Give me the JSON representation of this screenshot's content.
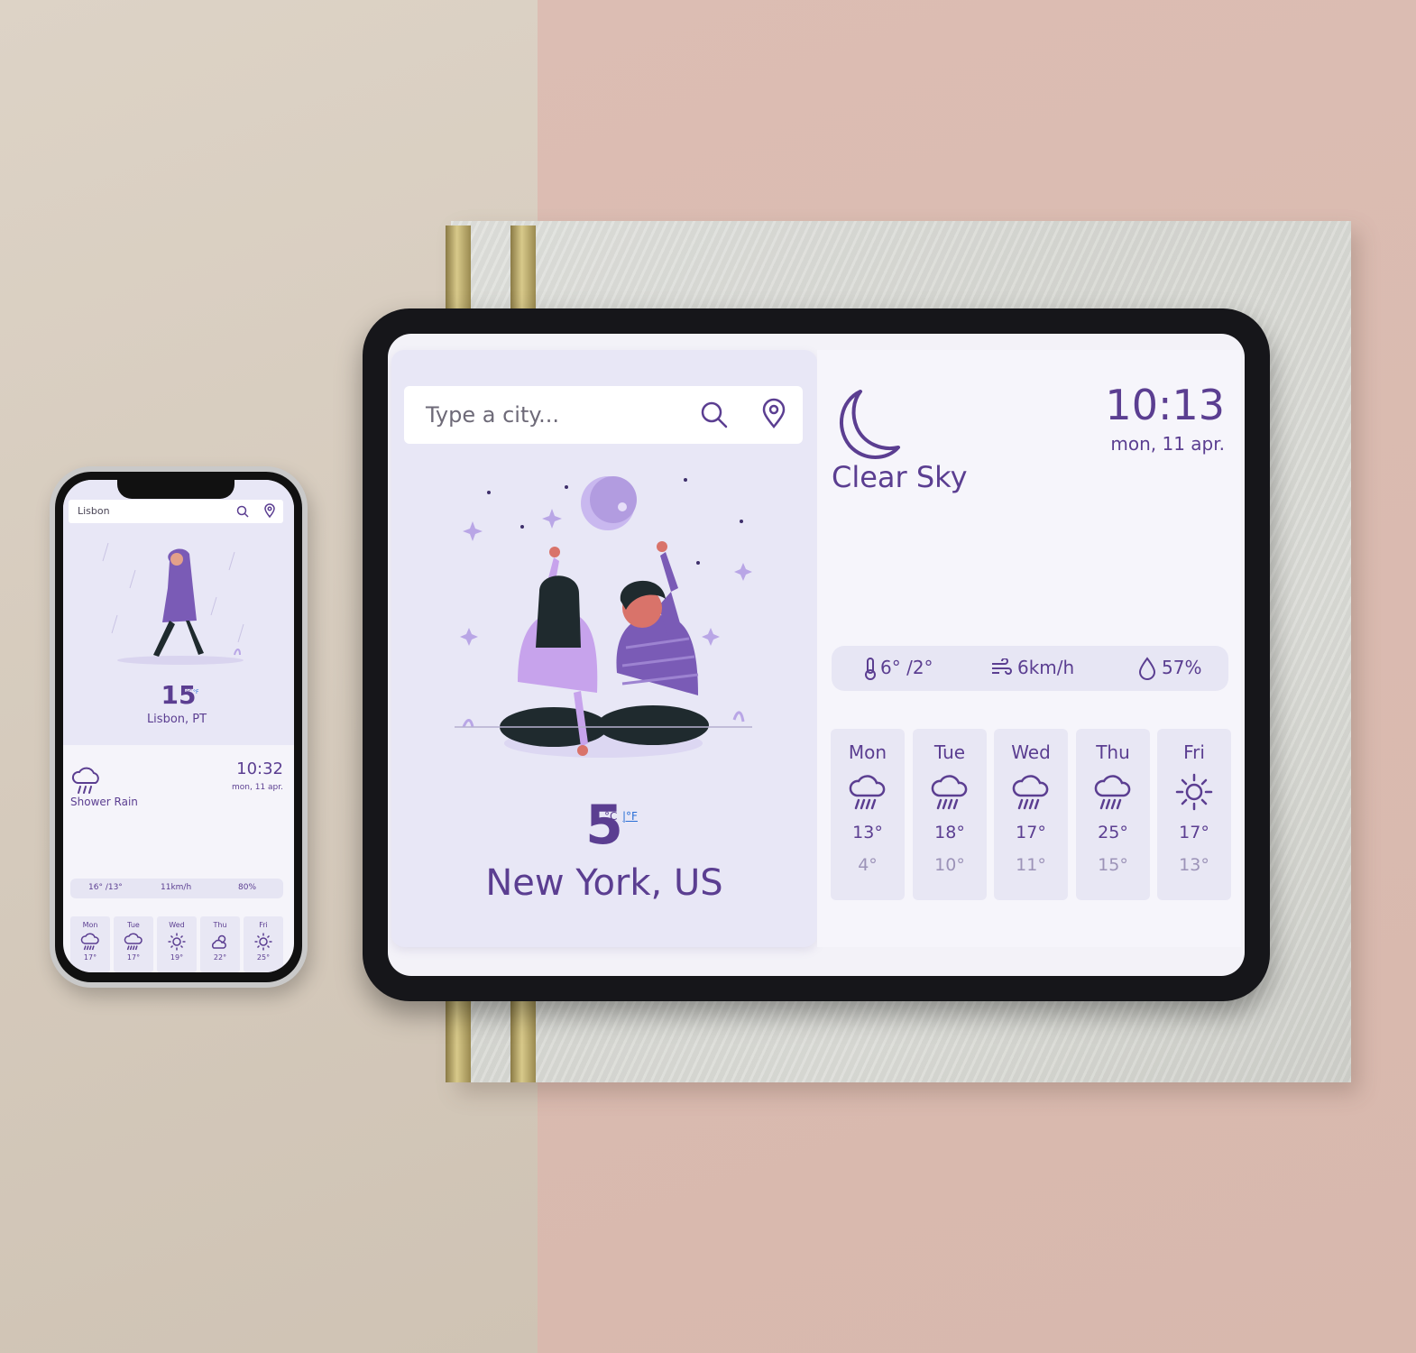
{
  "colors": {
    "accent": "#5b3e91",
    "panel": "#e8e7f6",
    "light_accent": "#b9a6e6"
  },
  "tablet": {
    "search": {
      "placeholder": "Type a city..."
    },
    "current": {
      "temp": "5",
      "unit_c": "°C",
      "unit_f": "|°F",
      "city": "New York, US"
    },
    "time": "10:13",
    "date": "mon, 11 apr.",
    "condition": "Clear Sky",
    "condition_icon": "moon-icon",
    "stats": {
      "temp": "6° /2°",
      "wind": "6km/h",
      "humidity": "57%"
    },
    "forecast": [
      {
        "day": "Mon",
        "icon": "rain-cloud-icon",
        "high": "13°",
        "low": "4°"
      },
      {
        "day": "Tue",
        "icon": "rain-cloud-icon",
        "high": "18°",
        "low": "10°"
      },
      {
        "day": "Wed",
        "icon": "rain-cloud-icon",
        "high": "17°",
        "low": "11°"
      },
      {
        "day": "Thu",
        "icon": "rain-cloud-icon",
        "high": "25°",
        "low": "15°"
      },
      {
        "day": "Fri",
        "icon": "sun-icon",
        "high": "17°",
        "low": "13°"
      }
    ]
  },
  "phone": {
    "search": {
      "value": "Lisbon"
    },
    "current": {
      "temp": "15",
      "unit_c": "°C",
      "unit_f": "°F",
      "city": "Lisbon, PT"
    },
    "time": "10:32",
    "date": "mon, 11 apr.",
    "condition": "Shower Rain",
    "condition_icon": "rain-cloud-icon",
    "stats": {
      "temp": "16° /13°",
      "wind": "11km/h",
      "humidity": "80%"
    },
    "forecast": [
      {
        "day": "Mon",
        "icon": "rain-cloud-icon",
        "high": "17°"
      },
      {
        "day": "Tue",
        "icon": "rain-cloud-icon",
        "high": "17°"
      },
      {
        "day": "Wed",
        "icon": "sun-icon",
        "high": "19°"
      },
      {
        "day": "Thu",
        "icon": "partly-cloudy-icon",
        "high": "22°"
      },
      {
        "day": "Fri",
        "icon": "sun-icon",
        "high": "25°"
      }
    ]
  }
}
